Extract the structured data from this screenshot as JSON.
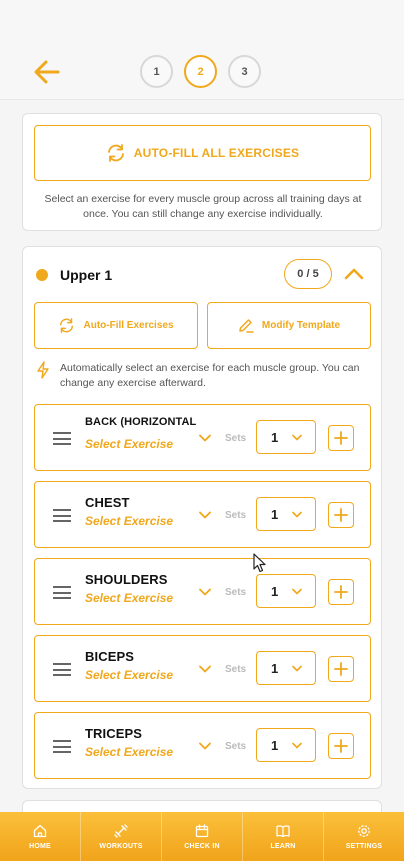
{
  "steps": [
    "1",
    "2",
    "3"
  ],
  "auto_fill_all": {
    "label": "AUTO-FILL ALL EXERCISES",
    "description": "Select an exercise for every muscle group across all training days at once. You can still change any exercise individually."
  },
  "day": {
    "title": "Upper 1",
    "count": "0 / 5",
    "auto_fill_label": "Auto-Fill Exercises",
    "modify_label": "Modify Template",
    "hint": "Automatically select an exercise for each muscle group. You can change any exercise afterward.",
    "sets_label": "Sets",
    "exercises": [
      {
        "name": "BACK (HORIZONTAL",
        "select": "Select Exercise",
        "sets": "1"
      },
      {
        "name": "CHEST",
        "select": "Select Exercise",
        "sets": "1"
      },
      {
        "name": "SHOULDERS",
        "select": "Select Exercise",
        "sets": "1"
      },
      {
        "name": "BICEPS",
        "select": "Select Exercise",
        "sets": "1"
      },
      {
        "name": "TRICEPS",
        "select": "Select Exercise",
        "sets": "1"
      }
    ]
  },
  "nav": [
    {
      "label": "HOME",
      "icon": "home-icon"
    },
    {
      "label": "WORKOUTS",
      "icon": "dumbbell-icon"
    },
    {
      "label": "CHECK IN",
      "icon": "calendar-icon"
    },
    {
      "label": "LEARN",
      "icon": "book-icon"
    },
    {
      "label": "SETTINGS",
      "icon": "gear-icon"
    }
  ],
  "colors": {
    "accent": "#f0a81c",
    "nav_bg": "#f5ad23"
  }
}
